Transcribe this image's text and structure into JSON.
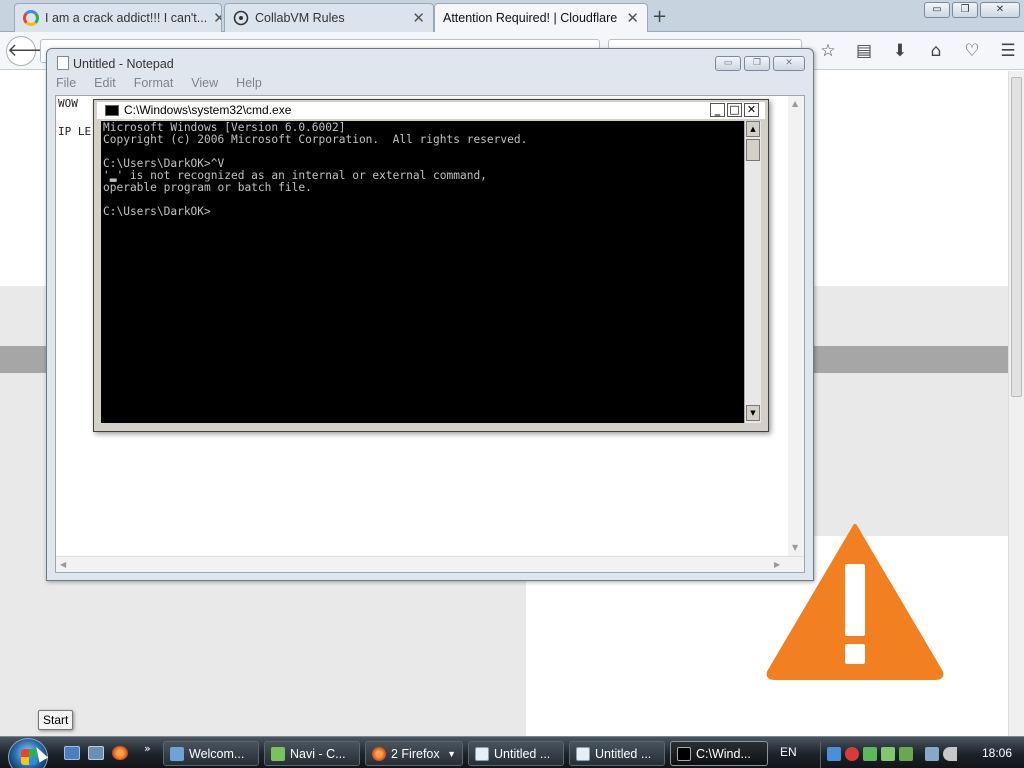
{
  "browser": {
    "tabs": [
      {
        "label": "I am a crack addict!!! I can't...",
        "icon": "google-icon",
        "active": false
      },
      {
        "label": "CollabVM Rules",
        "icon": "collabvm-icon",
        "active": false
      },
      {
        "label": "Attention Required! | Cloudflare",
        "icon": "none",
        "active": true
      }
    ],
    "new_tab_glyph": "+",
    "window_controls": {
      "minimize": "▭",
      "restore": "❐",
      "close": "✕"
    },
    "toolbar_icons": [
      "bookmark-star-icon",
      "reading-list-icon",
      "download-icon",
      "home-icon",
      "pocket-icon",
      "hamburger-menu-icon"
    ]
  },
  "page": {
    "warning_icon": "warning-triangle-icon",
    "accent_color": "#f38020"
  },
  "notepad": {
    "title": "Untitled - Notepad",
    "menu": [
      "File",
      "Edit",
      "Format",
      "View",
      "Help"
    ],
    "lines": [
      "WOW",
      "IP LE"
    ]
  },
  "cmd": {
    "title": "C:\\Windows\\system32\\cmd.exe",
    "output": "Microsoft Windows [Version 6.0.6002]\nCopyright (c) 2006 Microsoft Corporation.  All rights reserved.\n\nC:\\Users\\DarkOK>^V\n'▂' is not recognized as an internal or external command,\noperable program or batch file.\n\nC:\\Users\\DarkOK>"
  },
  "start_tooltip": "Start",
  "taskbar": {
    "tasks": [
      {
        "label": "Welcom...",
        "icon": "document-icon",
        "active": false
      },
      {
        "label": "Navi - C...",
        "icon": "navi-icon",
        "active": false
      },
      {
        "label": "2 Firefox",
        "icon": "firefox-icon",
        "active": false,
        "dropdown": "▼"
      },
      {
        "label": "Untitled ...",
        "icon": "notepad-icon",
        "active": false
      },
      {
        "label": "Untitled ...",
        "icon": "notepad-icon",
        "active": false
      },
      {
        "label": "C:\\Wind...",
        "icon": "cmd-icon",
        "active": true
      }
    ],
    "quicklaunch_more": "»",
    "language": "EN",
    "clock": "18:06"
  }
}
